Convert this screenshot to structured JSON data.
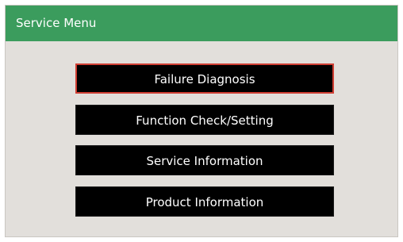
{
  "header": {
    "title": "Service Menu"
  },
  "menu": {
    "items": [
      {
        "label": "Failure Diagnosis",
        "selected": true
      },
      {
        "label": "Function Check/Setting",
        "selected": false
      },
      {
        "label": "Service Information",
        "selected": false
      },
      {
        "label": "Product Information",
        "selected": false
      }
    ]
  },
  "colors": {
    "title_bar": "#3b9c5d",
    "background": "#e2dfdb",
    "button": "#000000",
    "selection_border": "#cf3e33"
  }
}
